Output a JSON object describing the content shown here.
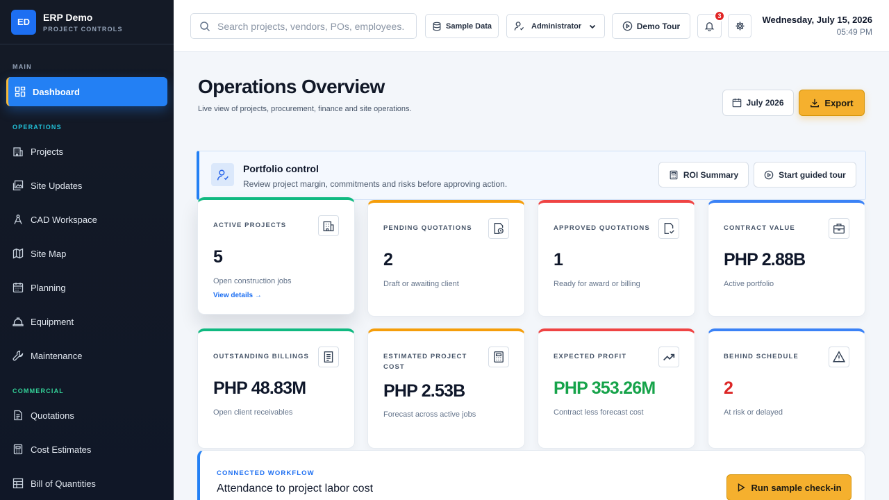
{
  "brand": {
    "initials": "ED",
    "title": "ERP Demo",
    "subtitle": "PROJECT CONTROLS"
  },
  "sidebar": {
    "sections": [
      {
        "label": "MAIN",
        "color": "#94a3b8"
      },
      {
        "label": "OPERATIONS",
        "color": "#22c1d8"
      },
      {
        "label": "COMMERCIAL",
        "color": "#34d399"
      }
    ],
    "items": [
      {
        "label": "Dashboard",
        "icon": "dashboard-icon",
        "active": true
      },
      {
        "label": "Projects",
        "icon": "building-icon"
      },
      {
        "label": "Site Updates",
        "icon": "image-icon"
      },
      {
        "label": "CAD Workspace",
        "icon": "compass-icon"
      },
      {
        "label": "Site Map",
        "icon": "map-icon"
      },
      {
        "label": "Planning",
        "icon": "calendar-icon"
      },
      {
        "label": "Equipment",
        "icon": "hard-hat-icon"
      },
      {
        "label": "Maintenance",
        "icon": "wrench-icon"
      },
      {
        "label": "Quotations",
        "icon": "document-icon"
      },
      {
        "label": "Cost Estimates",
        "icon": "calculator-icon"
      },
      {
        "label": "Bill of Quantities",
        "icon": "table-icon"
      }
    ]
  },
  "header": {
    "search_placeholder": "Search projects, vendors, POs, employees...",
    "sample_data_label": "Sample Data",
    "role_label": "Administrator",
    "demo_tour_label": "Demo Tour",
    "notification_count": "3",
    "date": "Wednesday, July 15, 2026",
    "time": "05:49 PM"
  },
  "main": {
    "title": "Operations Overview",
    "subtitle": "Live view of projects, procurement, finance and site operations.",
    "month_label": "July 2026",
    "export_label": "Export"
  },
  "portfolio": {
    "title": "Portfolio control",
    "subtitle": "Review project margin, commitments and risks before approving action.",
    "roi_label": "ROI Summary",
    "tour_label": "Start guided tour"
  },
  "cards": [
    {
      "label": "ACTIVE PROJECTS",
      "value": "5",
      "desc": "Open construction jobs",
      "link": "View details →",
      "accent": "#10b981",
      "value_color": "#0f172a",
      "icon": "building-icon"
    },
    {
      "label": "PENDING QUOTATIONS",
      "value": "2",
      "desc": "Draft or awaiting client",
      "accent": "#f59e0b",
      "value_color": "#0f172a",
      "icon": "file-clock-icon"
    },
    {
      "label": "APPROVED QUOTATIONS",
      "value": "1",
      "desc": "Ready for award or billing",
      "accent": "#ef4444",
      "value_color": "#0f172a",
      "icon": "file-check-icon"
    },
    {
      "label": "CONTRACT VALUE",
      "value": "PHP 2.88B",
      "desc": "Active portfolio",
      "accent": "#3b82f6",
      "value_color": "#0f172a",
      "icon": "briefcase-icon"
    },
    {
      "label": "OUTSTANDING BILLINGS",
      "value": "PHP 48.83M",
      "desc": "Open client receivables",
      "accent": "#10b981",
      "value_color": "#0f172a",
      "icon": "receipt-icon"
    },
    {
      "label": "ESTIMATED PROJECT COST",
      "value": "PHP 2.53B",
      "desc": "Forecast across active jobs",
      "accent": "#f59e0b",
      "value_color": "#0f172a",
      "icon": "calculator-icon"
    },
    {
      "label": "EXPECTED PROFIT",
      "value": "PHP 353.26M",
      "desc": "Contract less forecast cost",
      "accent": "#ef4444",
      "value_color": "#16a34a",
      "icon": "trending-up-icon"
    },
    {
      "label": "BEHIND SCHEDULE",
      "value": "2",
      "desc": "At risk or delayed",
      "accent": "#3b82f6",
      "value_color": "#dc2626",
      "icon": "warning-icon"
    }
  ],
  "workflow": {
    "label": "CONNECTED WORKFLOW",
    "title": "Attendance to project labor cost",
    "button_label": "Run sample check-in"
  }
}
